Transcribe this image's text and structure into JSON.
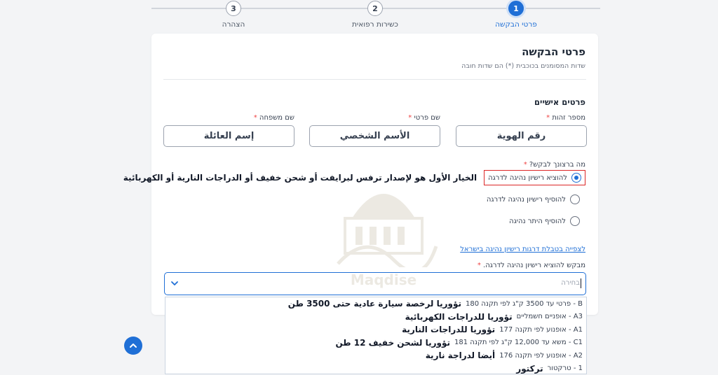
{
  "stepper": {
    "steps": [
      {
        "number": "1",
        "label": "פרטי הבקשה",
        "active": true
      },
      {
        "number": "2",
        "label": "כשירות רפואית",
        "active": false
      },
      {
        "number": "3",
        "label": "הצהרה",
        "active": false
      }
    ]
  },
  "form": {
    "title": "פרטי הבקשה",
    "subtitle": "שדות המסומנים בכוכבית (*) הם שדות חובה",
    "section_title": "פרטים אישיים",
    "fields": {
      "id_label": "מספר זהות",
      "id_value": "رقم الهوية",
      "first_name_label": "שם פרטי",
      "first_name_value": "الأسم الشخصي",
      "last_name_label": "שם משפחה",
      "last_name_value": "إسم العائلة"
    },
    "required_mark": "*",
    "question": "מה ברצונך לבקש?",
    "options": [
      {
        "label": "להוציא רישיון נהיגה לדרגה",
        "checked": true
      },
      {
        "label": "להוסיף רישיון נהיגה לדרגה",
        "checked": false
      },
      {
        "label": "להוסיף היתר נהיגה",
        "checked": false
      }
    ],
    "annotation": "الخيار الأول هو لإصدار ترفس لبرايفت أو شحن خفيف أو الدراجات النارية أو الكهربائية",
    "link_text": "לצפייה בטבלת דרגות רישיון נהיגה בישראל",
    "select_label": "מבקש להוציא רישיון נהיגה לדרגה.",
    "select_placeholder": "בחירה"
  },
  "dropdown": {
    "items": [
      {
        "code": "B - פרטי עד 3500 ק\"ג לפי תקנה 180",
        "arabic": "تؤوريا لرخصة سيارة عادية حتى 3500 طن"
      },
      {
        "code": "A3 - אופניים חשמליים",
        "arabic": "تؤوريا للدراجات الكهربائية"
      },
      {
        "code": "A1 - אופנוע לפי תקנה 177",
        "arabic": "تؤوريا للدراجات النارية"
      },
      {
        "code": "C1 - משא עד 12,000 ק\"ג לפי תקנה 181",
        "arabic": "تؤوريا لشحن خفيف 12 طن"
      },
      {
        "code": "A2 - אופנוע לפי תקנה 176",
        "arabic": "أيضا لدراجة نارية"
      },
      {
        "code": "1 - טרקטור",
        "arabic": "تركتور"
      }
    ]
  },
  "watermark": {
    "text": "Maqdise"
  },
  "colors": {
    "primary": "#1f6fd6",
    "required": "#ef4444",
    "highlight_border": "#dc2626"
  }
}
